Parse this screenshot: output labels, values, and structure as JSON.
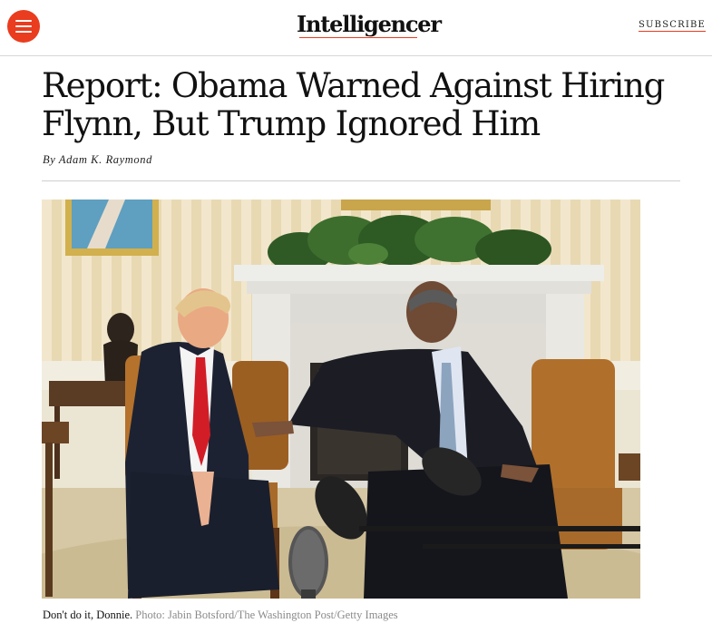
{
  "header": {
    "logo": "Intelligencer",
    "subscribe_label": "SUBSCRIBE",
    "menu_icon": "hamburger-menu-icon",
    "accent_color": "#ea3c1e"
  },
  "article": {
    "headline": "Report: Obama Warned Against Hiring Flynn, But Trump Ignored Him",
    "byline_prefix": "By",
    "author": "Adam K. Raymond",
    "caption": "Don't do it, Donnie.",
    "credit": "Photo: Jabin Botsford/The Washington Post/Getty Images"
  }
}
